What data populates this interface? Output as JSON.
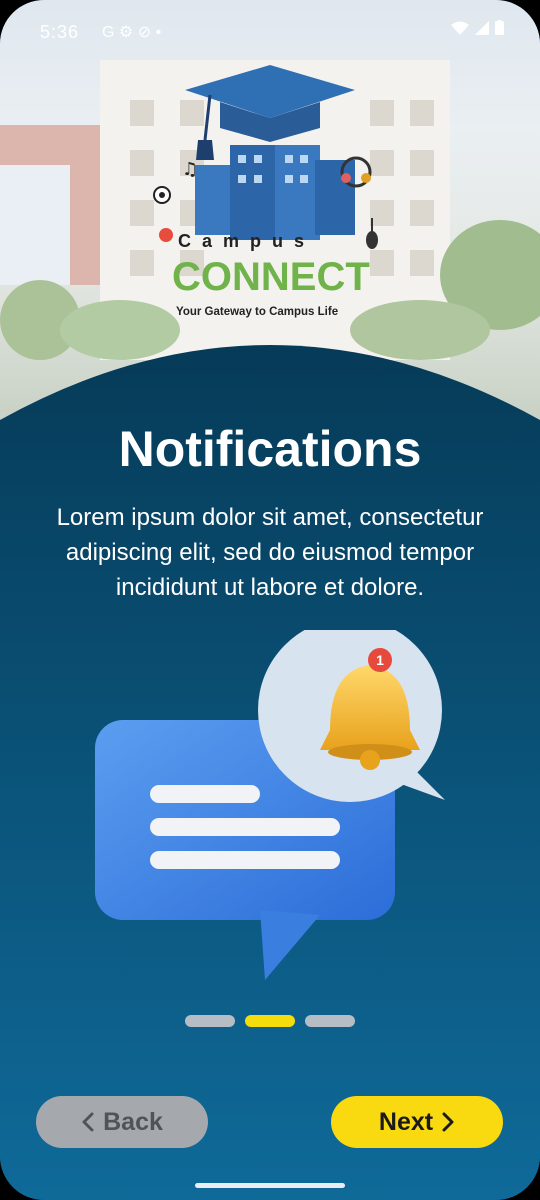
{
  "status_bar": {
    "time": "5:36",
    "left_icons": [
      "google-icon",
      "settings-icon",
      "dnd-icon",
      "dot-icon"
    ],
    "right_icons": [
      "wifi-icon",
      "signal-icon",
      "battery-icon"
    ]
  },
  "logo": {
    "brand_top": "Campus",
    "brand_main": "CONNECT",
    "tagline": "Your Gateway to Campus Life"
  },
  "onboarding": {
    "title": "Notifications",
    "description": "Lorem ipsum dolor sit amet, consectetur adipiscing elit, sed do eiusmod tempor incididunt ut labore et dolore.",
    "illustration": "chat-notification-illustration",
    "badge_count": "1",
    "page_indicator": {
      "total": 3,
      "active_index": 1
    }
  },
  "actions": {
    "back_label": "Back",
    "next_label": "Next"
  },
  "colors": {
    "panel_top": "#063b58",
    "panel_bottom": "#0f6a99",
    "accent_yellow": "#f9d90f",
    "back_button": "#a5a9ad",
    "dot_inactive": "#b7bdc4"
  }
}
